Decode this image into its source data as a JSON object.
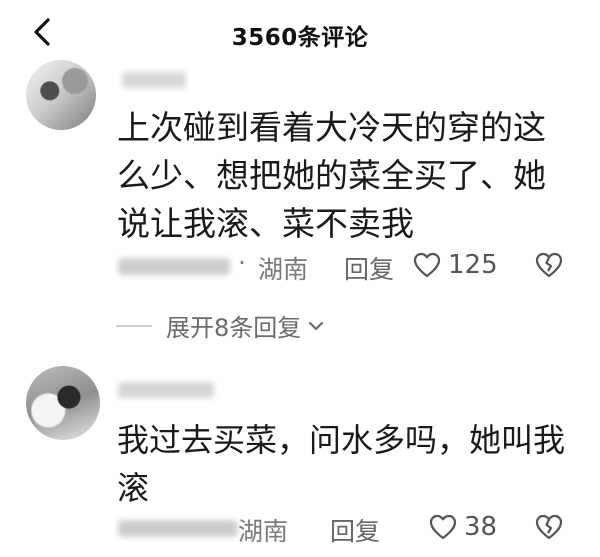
{
  "header": {
    "title": "3560条评论",
    "back_icon": "chevron-left-icon"
  },
  "comments": [
    {
      "text": "上次碰到看着大冷天的穿的这么少、想把她的菜全买了、她说让我滚、菜不卖我",
      "separator": "·",
      "location": "湖南",
      "reply_label": "回复",
      "like_count": "125"
    },
    {
      "text": "我过去买菜，问水多吗，她叫我滚",
      "location": "湖南",
      "reply_label": "回复",
      "like_count": "38"
    }
  ],
  "expand": {
    "label": "展开8条回复"
  },
  "colors": {
    "text": "#1a1a1a",
    "meta": "#7a7a7a",
    "icon": "#555555"
  }
}
